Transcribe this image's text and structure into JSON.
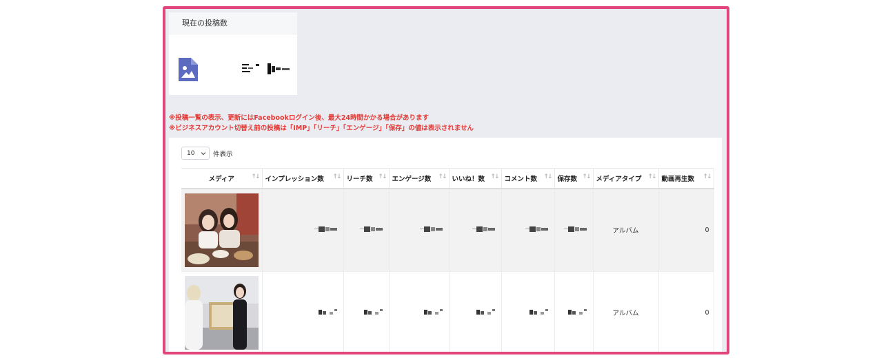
{
  "post_count_card": {
    "title": "現在の投稿数",
    "icon": "image-file-icon",
    "accent_color": "#5c6bc0"
  },
  "notices": [
    "※投稿一覧の表示、更新にはFacebookログイン後、最大24時間かかる場合があります",
    "※ビジネスアカウント切替え前の投稿は「IMP」「リーチ」「エンゲージ」「保存」の値は表示されません"
  ],
  "table": {
    "page_size": "10",
    "length_label": "件表示",
    "sort_glyph": "↑↓",
    "columns": [
      "メディア",
      "インプレッション数",
      "リーチ数",
      "エンゲージ数",
      "いいね！数",
      "コメント数",
      "保存数",
      "メディアタイプ",
      "動画再生数"
    ],
    "rows": [
      {
        "media": "photo-thumbnail",
        "media_type": "アルバム",
        "video_plays": "0"
      },
      {
        "media": "photo-thumbnail",
        "media_type": "アルバム",
        "video_plays": "0"
      }
    ]
  },
  "colors": {
    "frame_border": "#e0457b",
    "notice_text": "#e53935",
    "panel_bg": "#eaecf1"
  }
}
